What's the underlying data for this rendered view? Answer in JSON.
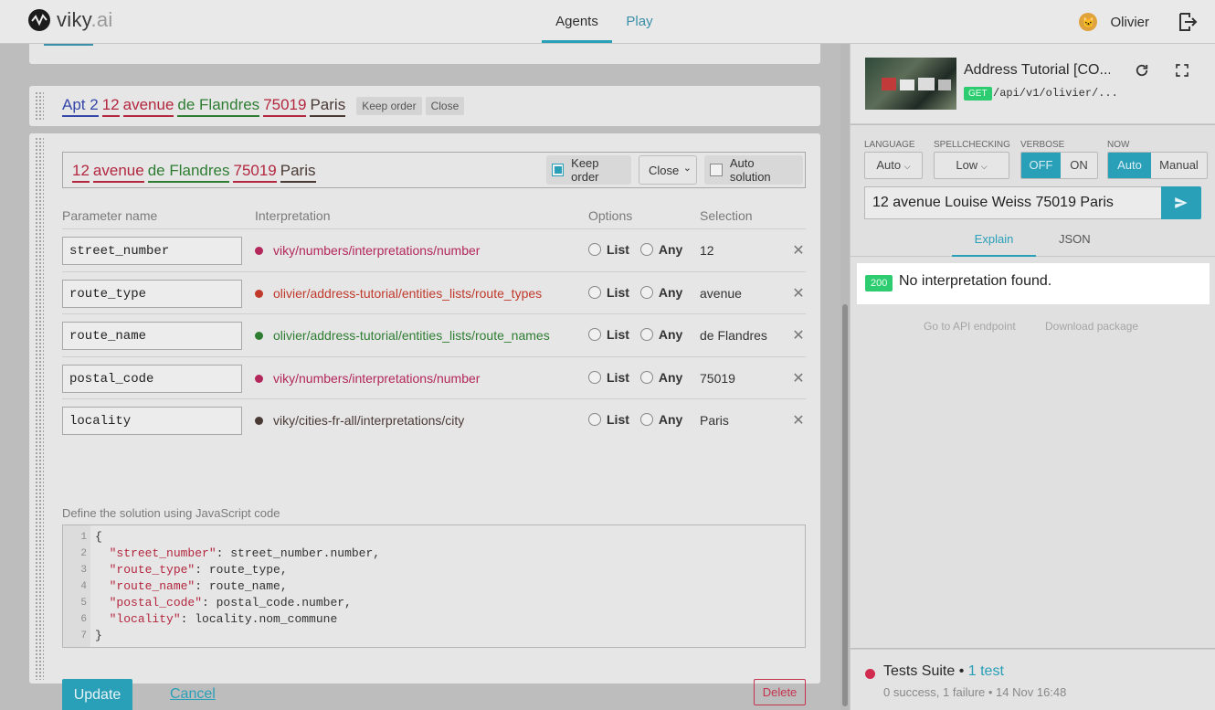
{
  "header": {
    "logo_main": "viky",
    "logo_suffix": ".ai",
    "nav": [
      {
        "label": "Agents"
      },
      {
        "label": "Play"
      }
    ],
    "user_name": "Olivier"
  },
  "card_top": {},
  "formulation": {
    "tokens": [
      {
        "text": "Apt 2",
        "color": "blue"
      },
      {
        "text": "12",
        "color": "red"
      },
      {
        "text": "avenue",
        "color": "red"
      },
      {
        "text": "de Flandres",
        "color": "green"
      },
      {
        "text": "75019",
        "color": "red"
      },
      {
        "text": "Paris",
        "color": "brown"
      }
    ],
    "keep_order_chip": "Keep order",
    "close_chip": "Close"
  },
  "editor": {
    "tokens": [
      {
        "text": "12",
        "color": "red"
      },
      {
        "text": "avenue",
        "color": "red"
      },
      {
        "text": "de Flandres",
        "color": "green"
      },
      {
        "text": "75019",
        "color": "red"
      },
      {
        "text": "Paris",
        "color": "brown"
      }
    ],
    "keep_order_label": "Keep order",
    "keep_order_checked": true,
    "proximity_value": "Close",
    "auto_solution_label": "Auto solution",
    "auto_solution_checked": false,
    "columns": {
      "param": "Parameter name",
      "interpretation": "Interpretation",
      "options": "Options",
      "selection": "Selection"
    },
    "option_list": "List",
    "option_any": "Any",
    "rows": [
      {
        "param": "street_number",
        "interpretation": "viky/numbers/interpretations/number",
        "color": "#b3275a",
        "selection": "12"
      },
      {
        "param": "route_type",
        "interpretation": "olivier/address-tutorial/entities_lists/route_types",
        "color": "#c0392b",
        "selection": "avenue"
      },
      {
        "param": "route_name",
        "interpretation": "olivier/address-tutorial/entities_lists/route_names",
        "color": "#2e7d32",
        "selection": "de Flandres"
      },
      {
        "param": "postal_code",
        "interpretation": "viky/numbers/interpretations/number",
        "color": "#b3275a",
        "selection": "75019"
      },
      {
        "param": "locality",
        "interpretation": "viky/cities-fr-all/interpretations/city",
        "color": "#4a3a35",
        "selection": "Paris"
      }
    ],
    "code_label": "Define the solution using JavaScript code",
    "code_lines": [
      {
        "n": "1",
        "key": "",
        "rest": "{"
      },
      {
        "n": "2",
        "key": "\"street_number\"",
        "rest": ": street_number.number,"
      },
      {
        "n": "3",
        "key": "\"route_type\"",
        "rest": ": route_type,"
      },
      {
        "n": "4",
        "key": "\"route_name\"",
        "rest": ": route_name,"
      },
      {
        "n": "5",
        "key": "\"postal_code\"",
        "rest": ": postal_code.number,"
      },
      {
        "n": "6",
        "key": "\"locality\"",
        "rest": ": locality.nom_commune"
      },
      {
        "n": "7",
        "key": "",
        "rest": "}"
      }
    ],
    "update_label": "Update",
    "cancel_label": "Cancel",
    "delete_label": "Delete"
  },
  "play": {
    "title": "Address Tutorial [CO...",
    "method": "GET",
    "path": "/api/v1/olivier/...",
    "language_label": "LANGUAGE",
    "language_value": "Auto",
    "spellchecking_label": "SPELLCHECKING",
    "spellchecking_value": "Low",
    "verbose_label": "VERBOSE",
    "verbose_off": "OFF",
    "verbose_on": "ON",
    "now_label": "NOW",
    "now_auto": "Auto",
    "now_manual": "Manual",
    "query": "12 avenue Louise Weiss 75019 Paris",
    "tab_explain": "Explain",
    "tab_json": "JSON",
    "status_code": "200",
    "result": "No interpretation found.",
    "link_api": "Go to API endpoint",
    "link_download": "Download package"
  },
  "tests": {
    "title": "Tests Suite",
    "count": "1 test",
    "summary": "0 success, 1 failure • 14 Nov 16:48"
  }
}
